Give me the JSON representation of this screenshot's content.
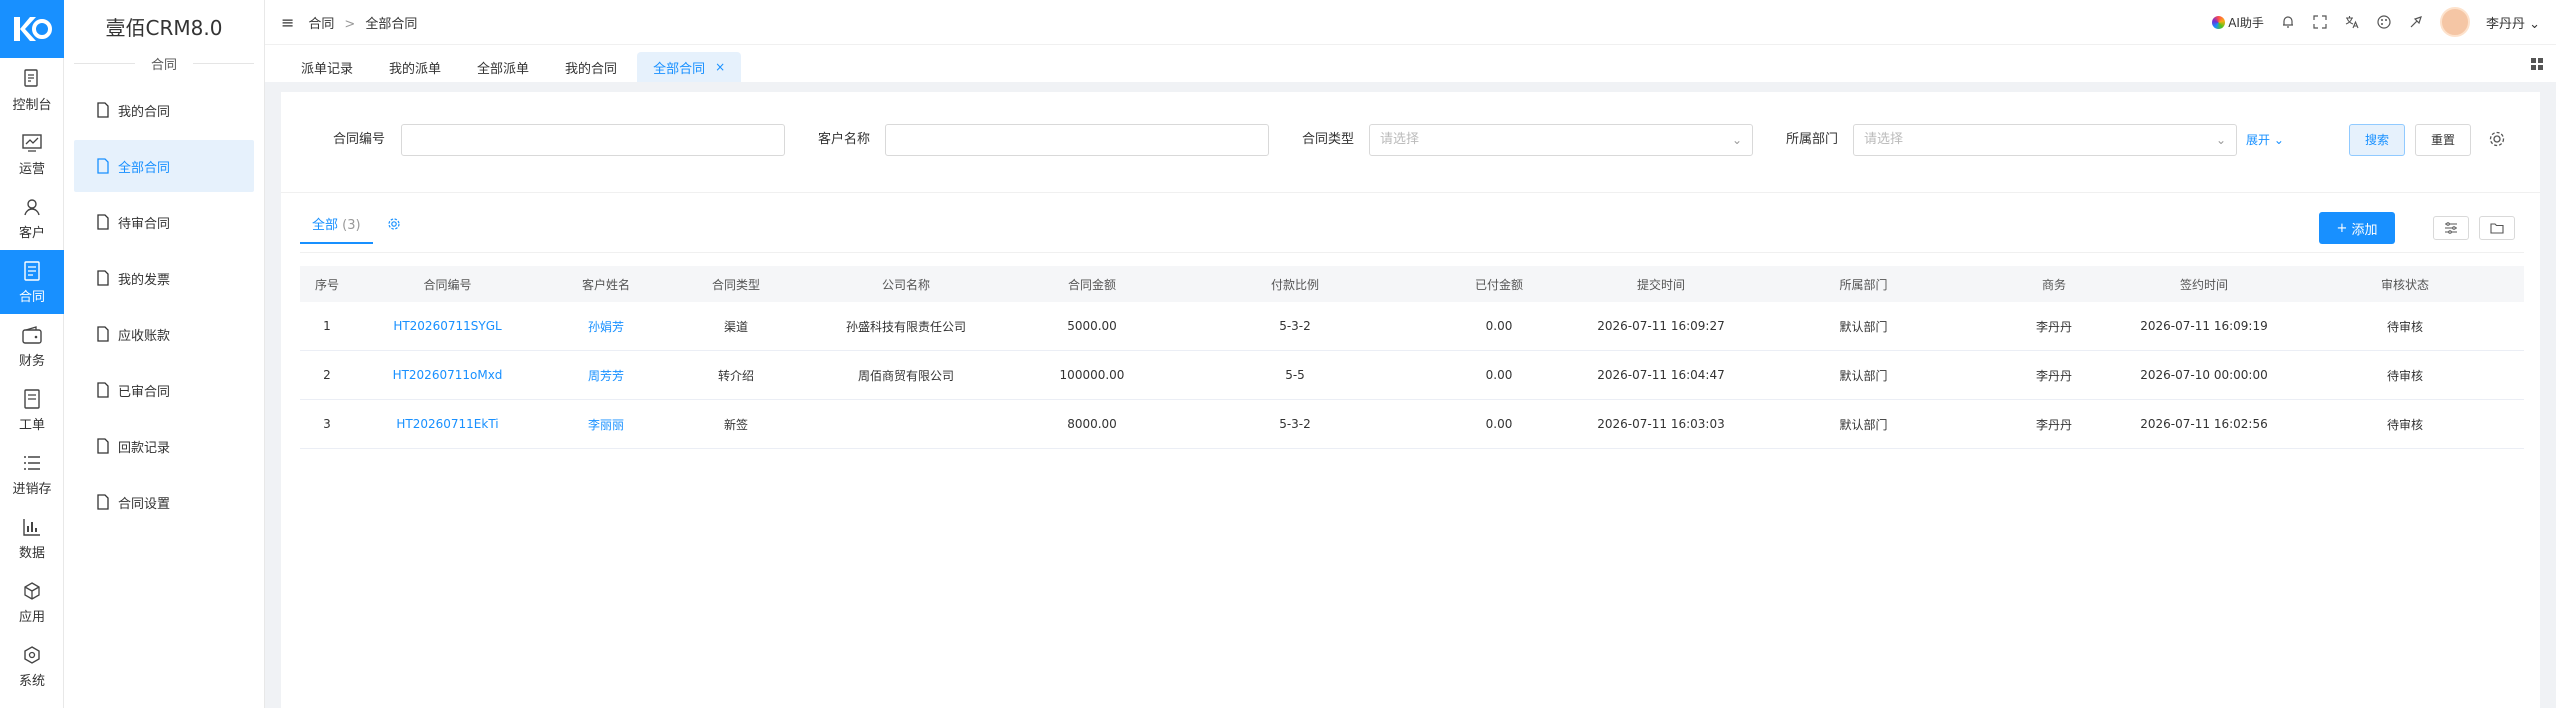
{
  "app": {
    "title": "壹佰CRM8.0",
    "section": "合同"
  },
  "rail": [
    {
      "label": "控制台",
      "icon": "dashboard-icon"
    },
    {
      "label": "运营",
      "icon": "chart-line-icon"
    },
    {
      "label": "客户",
      "icon": "user-icon"
    },
    {
      "label": "合同",
      "icon": "contract-icon",
      "active": true
    },
    {
      "label": "财务",
      "icon": "wallet-icon"
    },
    {
      "label": "工单",
      "icon": "ticket-icon"
    },
    {
      "label": "进销存",
      "icon": "list-icon"
    },
    {
      "label": "数据",
      "icon": "bar-chart-icon"
    },
    {
      "label": "应用",
      "icon": "cube-icon"
    },
    {
      "label": "系统",
      "icon": "hexagon-icon"
    }
  ],
  "submenu": [
    {
      "label": "我的合同"
    },
    {
      "label": "全部合同",
      "active": true
    },
    {
      "label": "待审合同"
    },
    {
      "label": "我的发票"
    },
    {
      "label": "应收账款"
    },
    {
      "label": "已审合同"
    },
    {
      "label": "回款记录"
    },
    {
      "label": "合同设置"
    }
  ],
  "header": {
    "breadcrumb": [
      "合同",
      "全部合同"
    ],
    "ai_label": "AI助手",
    "user_name": "李丹丹"
  },
  "tabs": [
    {
      "label": "派单记录"
    },
    {
      "label": "我的派单"
    },
    {
      "label": "全部派单"
    },
    {
      "label": "我的合同"
    },
    {
      "label": "全部合同",
      "active": true,
      "close": "×"
    }
  ],
  "filters": {
    "contract_no_label": "合同编号",
    "customer_label": "客户名称",
    "type_label": "合同类型",
    "type_placeholder": "请选择",
    "dept_label": "所属部门",
    "dept_placeholder": "请选择",
    "expand": "展开",
    "search": "搜索",
    "reset": "重置"
  },
  "list": {
    "tab_all": "全部",
    "tab_count": "(3)",
    "add": "添加"
  },
  "table": {
    "columns": [
      "序号",
      "合同编号",
      "客户姓名",
      "合同类型",
      "公司名称",
      "合同金额",
      "付款比例",
      "已付金额",
      "提交时间",
      "所属部门",
      "商务",
      "签约时间",
      "审核状态"
    ],
    "rows": [
      [
        "1",
        "HT20260711SYGL",
        "孙娟芳",
        "渠道",
        "孙盛科技有限责任公司",
        "5000.00",
        "5-3-2",
        "0.00",
        "2026-07-11 16:09:27",
        "默认部门",
        "李丹丹",
        "2026-07-11 16:09:19",
        "待审核"
      ],
      [
        "2",
        "HT20260711oMxd",
        "周芳芳",
        "转介绍",
        "周佰商贸有限公司",
        "100000.00",
        "5-5",
        "0.00",
        "2026-07-11 16:04:47",
        "默认部门",
        "李丹丹",
        "2026-07-10 00:00:00",
        "待审核"
      ],
      [
        "3",
        "HT20260711EkTi",
        "李丽丽",
        "新签",
        "",
        "8000.00",
        "5-3-2",
        "0.00",
        "2026-07-11 16:03:03",
        "默认部门",
        "李丹丹",
        "2026-07-11 16:02:56",
        "待审核"
      ]
    ]
  },
  "colors": {
    "accent": "#1890ff",
    "active_bg": "#e6f1fc"
  }
}
